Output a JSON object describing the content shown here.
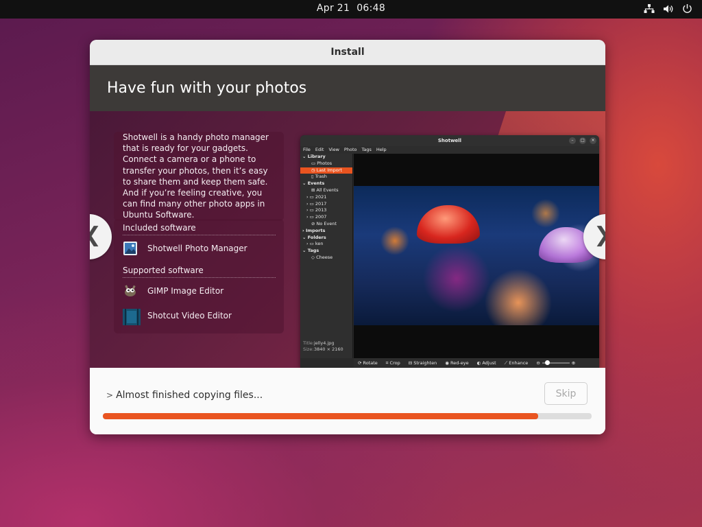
{
  "topbar": {
    "date": "Apr 21",
    "time": "06:48"
  },
  "window": {
    "title": "Install"
  },
  "slide": {
    "heading": "Have fun with your photos",
    "description": "Shotwell is a handy photo manager that is ready for your gadgets. Connect a camera or a phone to transfer your photos, then it’s easy to share them and keep them safe. And if you’re feeling creative, you can find many other photo apps in Ubuntu Software.",
    "included_label": "Included software",
    "included": [
      {
        "name": "Shotwell Photo Manager",
        "icon": "shotwell-icon"
      }
    ],
    "supported_label": "Supported software",
    "supported": [
      {
        "name": "GIMP Image Editor",
        "icon": "gimp-icon"
      },
      {
        "name": "Shotcut Video Editor",
        "icon": "shotcut-icon"
      }
    ],
    "prev_arrow": "❮",
    "next_arrow": "❯"
  },
  "shotwell": {
    "title": "Shotwell",
    "menu": [
      "File",
      "Edit",
      "View",
      "Photo",
      "Tags",
      "Help"
    ],
    "sidebar": {
      "library": "Library",
      "photos": "Photos",
      "last_import": "Last Import",
      "trash": "Trash",
      "events": "Events",
      "all_events": "All Events",
      "years": [
        "2021",
        "2017",
        "2013",
        "2007"
      ],
      "no_event": "No Event",
      "imports": "Imports",
      "folders": "Folders",
      "folder_ken": "ken",
      "tags": "Tags",
      "tag_cheese": "Cheese"
    },
    "meta": {
      "title_label": "Title:",
      "title_value": "jelly4.jpg",
      "size_label": "Size:",
      "size_value": "3840 × 2160"
    },
    "toolbar": [
      "Rotate",
      "Crop",
      "Straighten",
      "Red-eye",
      "Adjust",
      "Enhance"
    ]
  },
  "bottom": {
    "status": "Almost finished copying files...",
    "skip_label": "Skip",
    "progress_fraction": 0.891
  },
  "colors": {
    "accent": "#e95420",
    "header_bg": "#3d3a38"
  }
}
